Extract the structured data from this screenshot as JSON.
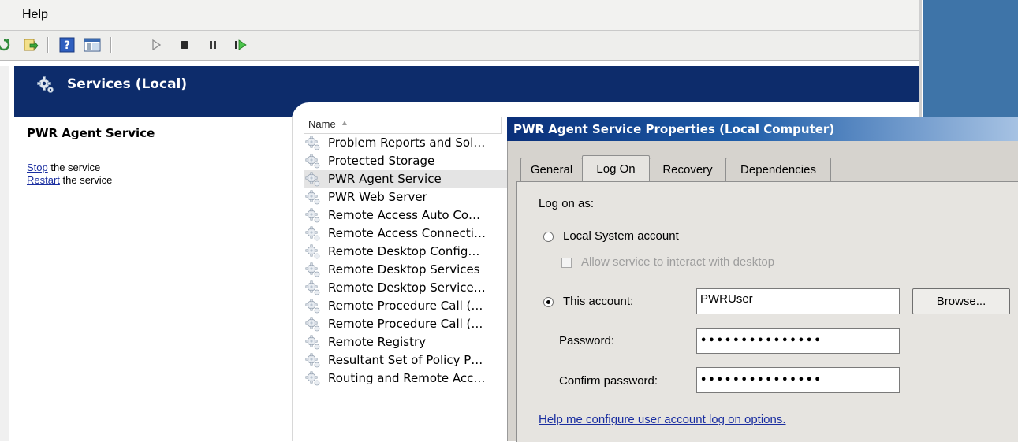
{
  "menu": {
    "help_label": "Help"
  },
  "toolbar": {
    "icons": [
      "refresh-icon",
      "export-list-icon",
      "help-icon",
      "show-hide-console-tree-icon",
      "start-service-icon",
      "stop-service-icon",
      "pause-service-icon",
      "resume-service-icon"
    ]
  },
  "header": {
    "title": "Services (Local)"
  },
  "left_panel": {
    "service_name": "PWR Agent Service",
    "stop_link": "Stop",
    "stop_suffix": " the service",
    "restart_link": "Restart",
    "restart_suffix": " the service"
  },
  "service_list": {
    "column_header": "Name",
    "rows": [
      "Problem Reports and Sol…",
      "Protected Storage",
      "PWR Agent Service",
      "PWR Web Server",
      "Remote Access Auto Co…",
      "Remote Access Connecti…",
      "Remote Desktop Config…",
      "Remote Desktop Services",
      "Remote Desktop Service…",
      "Remote Procedure Call (…",
      "Remote Procedure Call (…",
      "Remote Registry",
      "Resultant Set of Policy P…",
      "Routing and Remote Acc…"
    ],
    "selected_index": 2
  },
  "dialog": {
    "title": "PWR Agent Service Properties (Local Computer)",
    "tabs": [
      "General",
      "Log On",
      "Recovery",
      "Dependencies"
    ],
    "active_tab": "Log On",
    "log_on_as_label": "Log on as:",
    "local_system_label": "Local System account",
    "interact_desktop_label": "Allow service to interact with desktop",
    "this_account_label": "This account:",
    "this_account_value": "PWRUser",
    "browse_label": "Browse...",
    "password_label": "Password:",
    "password_value": "•••••••••••••••",
    "confirm_password_label": "Confirm password:",
    "confirm_password_value": "•••••••••••••••",
    "help_link": "Help me configure user account log on options.",
    "selected_option": "This account"
  },
  "colors": {
    "header_band": "#0d2c6b",
    "desktop": "#3e74a8",
    "link": "#1a2ea0"
  }
}
